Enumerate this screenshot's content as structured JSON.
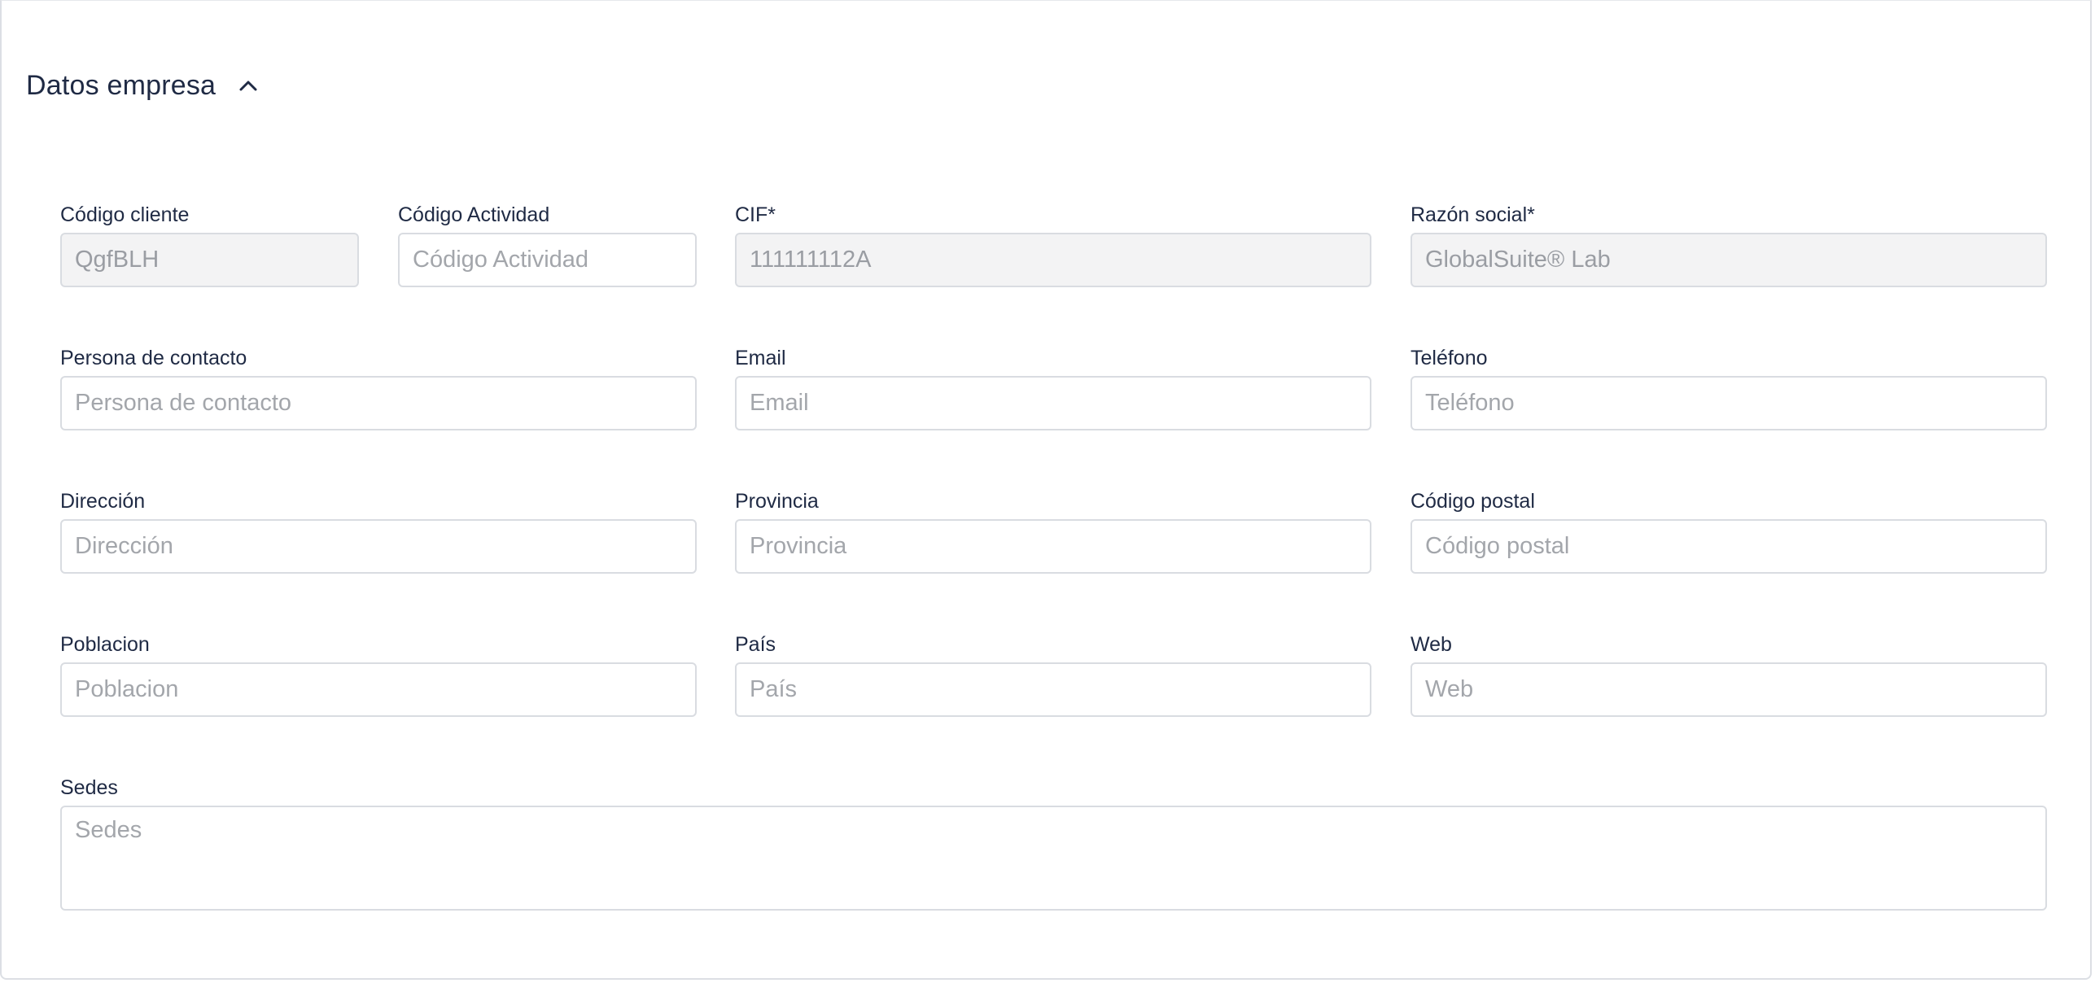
{
  "section": {
    "title": "Datos empresa",
    "chevron_icon": "chevron-up-icon"
  },
  "fields": {
    "codigo_cliente": {
      "label": "Código cliente",
      "value": "QgfBLH",
      "placeholder": ""
    },
    "codigo_actividad": {
      "label": "Código Actividad",
      "value": "",
      "placeholder": "Código Actividad"
    },
    "cif": {
      "label": "CIF*",
      "value": "111111112A",
      "placeholder": ""
    },
    "razon_social": {
      "label": "Razón social*",
      "value": "GlobalSuite® Lab",
      "placeholder": ""
    },
    "persona_contacto": {
      "label": "Persona de contacto",
      "value": "",
      "placeholder": "Persona de contacto"
    },
    "email": {
      "label": "Email",
      "value": "",
      "placeholder": "Email"
    },
    "telefono": {
      "label": "Teléfono",
      "value": "",
      "placeholder": "Teléfono"
    },
    "direccion": {
      "label": "Dirección",
      "value": "",
      "placeholder": "Dirección"
    },
    "provincia": {
      "label": "Provincia",
      "value": "",
      "placeholder": "Provincia"
    },
    "codigo_postal": {
      "label": "Código postal",
      "value": "",
      "placeholder": "Código postal"
    },
    "poblacion": {
      "label": "Poblacion",
      "value": "",
      "placeholder": "Poblacion"
    },
    "pais": {
      "label": "País",
      "value": "",
      "placeholder": "País"
    },
    "web": {
      "label": "Web",
      "value": "",
      "placeholder": "Web"
    },
    "sedes": {
      "label": "Sedes",
      "value": "",
      "placeholder": "Sedes"
    }
  },
  "colors": {
    "text": "#1f2a44",
    "border": "#d9dce1",
    "readonly_bg": "#f3f3f4",
    "placeholder": "#a3a6ab"
  }
}
